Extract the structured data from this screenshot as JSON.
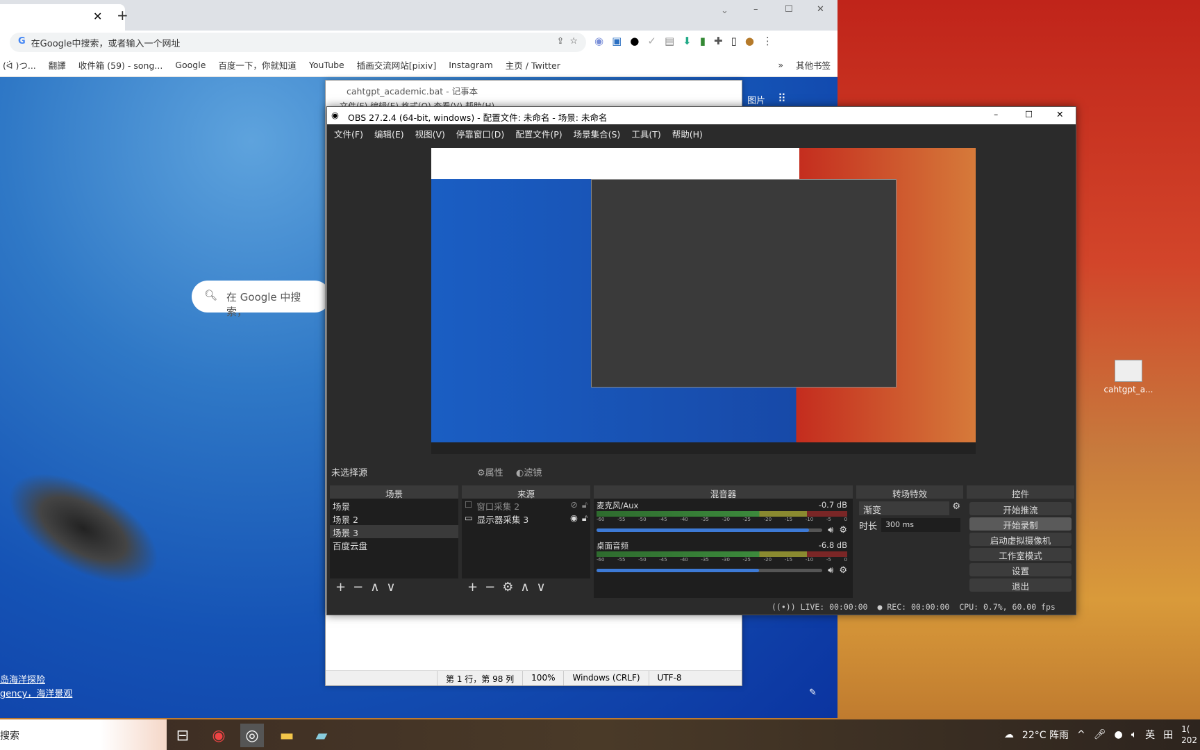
{
  "chrome": {
    "address_placeholder": "在Google中搜索，或者输入一个网址",
    "bookmarks": [
      "(ᐛ )つ...",
      "翻譯",
      "收件箱 (59) - song...",
      "Google",
      "百度一下，你就知道",
      "YouTube",
      "插画交流网站[pixiv]",
      "Instagram",
      "主页 / Twitter"
    ],
    "other_bookmarks": "其他书签",
    "google_search_placeholder": "在 Google 中搜索，",
    "images_link": "图片",
    "caption_line1": "岛海洋探险",
    "caption_line2": "gency，海洋景观"
  },
  "notepad": {
    "title": "cahtgpt_academic.bat - 记事本",
    "menu": "文件(F)  编辑(E)  格式(O)  查看(V)  帮助(H)",
    "status": {
      "position": "第 1 行，第 98 列",
      "zoom": "100%",
      "eol": "Windows (CRLF)",
      "encoding": "UTF-8"
    }
  },
  "obs": {
    "title": "OBS 27.2.4 (64-bit, windows) - 配置文件: 未命名 - 场景: 未命名",
    "menu": [
      "文件(F)",
      "编辑(E)",
      "视图(V)",
      "停靠窗口(D)",
      "配置文件(P)",
      "场景集合(S)",
      "工具(T)",
      "帮助(H)"
    ],
    "no_source": "未选择源",
    "properties": "属性",
    "filters": "滤镜",
    "docks": {
      "scenes": {
        "title": "场景",
        "items": [
          "场景",
          "场景 2",
          "场景 3",
          "百度云盘"
        ],
        "selected": 2
      },
      "sources": {
        "title": "来源",
        "items": [
          {
            "name": "窗口采集 2",
            "visible": false
          },
          {
            "name": "显示器采集 3",
            "visible": true
          }
        ]
      },
      "mixer": {
        "title": "混音器",
        "tracks": [
          {
            "name": "麦克风/Aux",
            "db": "-0.7 dB",
            "volume": 0.94
          },
          {
            "name": "桌面音频",
            "db": "-6.8 dB",
            "volume": 0.72
          }
        ],
        "scale": [
          "-60",
          "-55",
          "-50",
          "-45",
          "-40",
          "-35",
          "-30",
          "-25",
          "-20",
          "-15",
          "-10",
          "-5",
          "0"
        ]
      },
      "transitions": {
        "title": "转场特效",
        "selected": "渐变",
        "duration_label": "时长",
        "duration": "300 ms"
      },
      "controls": {
        "title": "控件",
        "buttons": [
          "开始推流",
          "开始录制",
          "启动虚拟摄像机",
          "工作室模式",
          "设置",
          "退出"
        ]
      }
    },
    "status": {
      "live": "LIVE: 00:00:00",
      "rec": "REC: 00:00:00",
      "cpu": "CPU: 0.7%, 60.00 fps"
    }
  },
  "desktop": {
    "icon_label": "cahtgpt_a..."
  },
  "taskbar": {
    "search": "搜索",
    "weather": "22°C 阵雨",
    "ime": "英",
    "clock_line1": "1(",
    "clock_line2": "202"
  }
}
